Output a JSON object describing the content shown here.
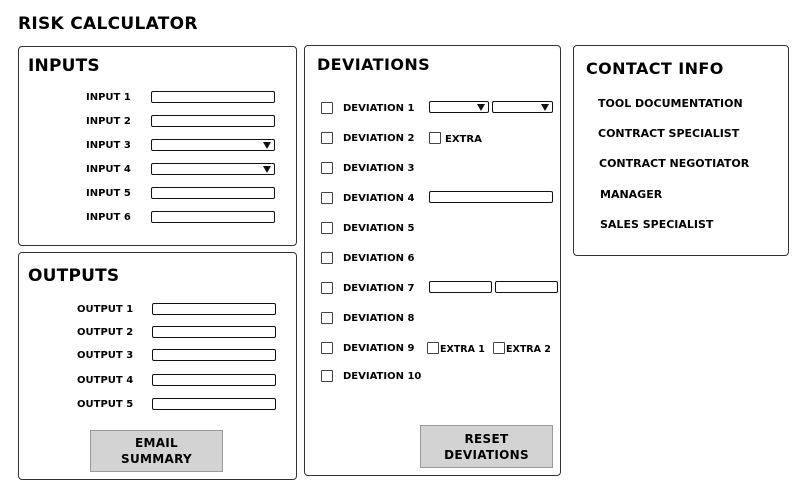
{
  "app_title": "RISK CALCULATOR",
  "inputs": {
    "title": "INPUTS",
    "rows": [
      {
        "label": "INPUT 1",
        "control": "text"
      },
      {
        "label": "INPUT 2",
        "control": "text"
      },
      {
        "label": "INPUT 3",
        "control": "dropdown"
      },
      {
        "label": "INPUT 4",
        "control": "dropdown"
      },
      {
        "label": "INPUT 5",
        "control": "text"
      },
      {
        "label": "INPUT 6",
        "control": "text"
      }
    ]
  },
  "outputs": {
    "title": "OUTPUTS",
    "rows": [
      "OUTPUT 1",
      "OUTPUT 2",
      "OUTPUT 3",
      "OUTPUT 4",
      "OUTPUT 5"
    ],
    "email_button": "EMAIL\nSUMMARY"
  },
  "deviations": {
    "title": "DEVIATIONS",
    "items": [
      {
        "label": "DEVIATION 1",
        "extras": "two-dropdowns"
      },
      {
        "label": "DEVIATION 2",
        "extra_checkbox": "EXTRA"
      },
      {
        "label": "DEVIATION 3"
      },
      {
        "label": "DEVIATION 4",
        "extras": "one-text"
      },
      {
        "label": "DEVIATION 5"
      },
      {
        "label": "DEVIATION 6"
      },
      {
        "label": "DEVIATION 7",
        "extras": "two-text"
      },
      {
        "label": "DEVIATION 8"
      },
      {
        "label": "DEVIATION 9",
        "extra_checkboxes": [
          "EXTRA 1",
          "EXTRA 2"
        ]
      },
      {
        "label": "DEVIATION 10"
      }
    ],
    "reset_button": "RESET\nDEVIATIONS"
  },
  "contact": {
    "title": "CONTACT INFO",
    "links": [
      "TOOL DOCUMENTATION",
      "CONTRACT SPECIALIST",
      "CONTRACT NEGOTIATOR",
      "MANAGER",
      "SALES SPECIALIST"
    ]
  },
  "icons": {
    "dropdown_arrow": "triangle-down-icon",
    "checkbox": "checkbox-icon"
  },
  "colors": {
    "button_bg": "#d3d3d3",
    "border": "#333333"
  }
}
